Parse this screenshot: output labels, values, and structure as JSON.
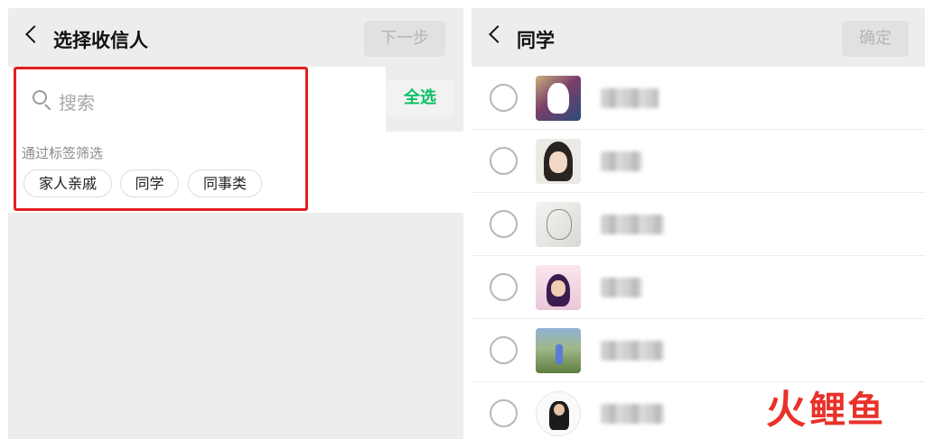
{
  "select_recipients": {
    "title": "选择收信人",
    "next_button": "下一步",
    "search_placeholder": "搜索",
    "select_all": "全选",
    "tag_caption": "通过标签筛选",
    "tags": [
      "家人亲戚",
      "同学",
      "同事类"
    ]
  },
  "classmates": {
    "title": "同学",
    "confirm_button": "确定",
    "contact_count": 6
  },
  "watermark": {
    "text_first": "火",
    "text_rest": "鲤鱼"
  },
  "colors": {
    "accent_green": "#07c160",
    "highlight_red": "#e02020",
    "watermark_red": "#e8322a"
  }
}
